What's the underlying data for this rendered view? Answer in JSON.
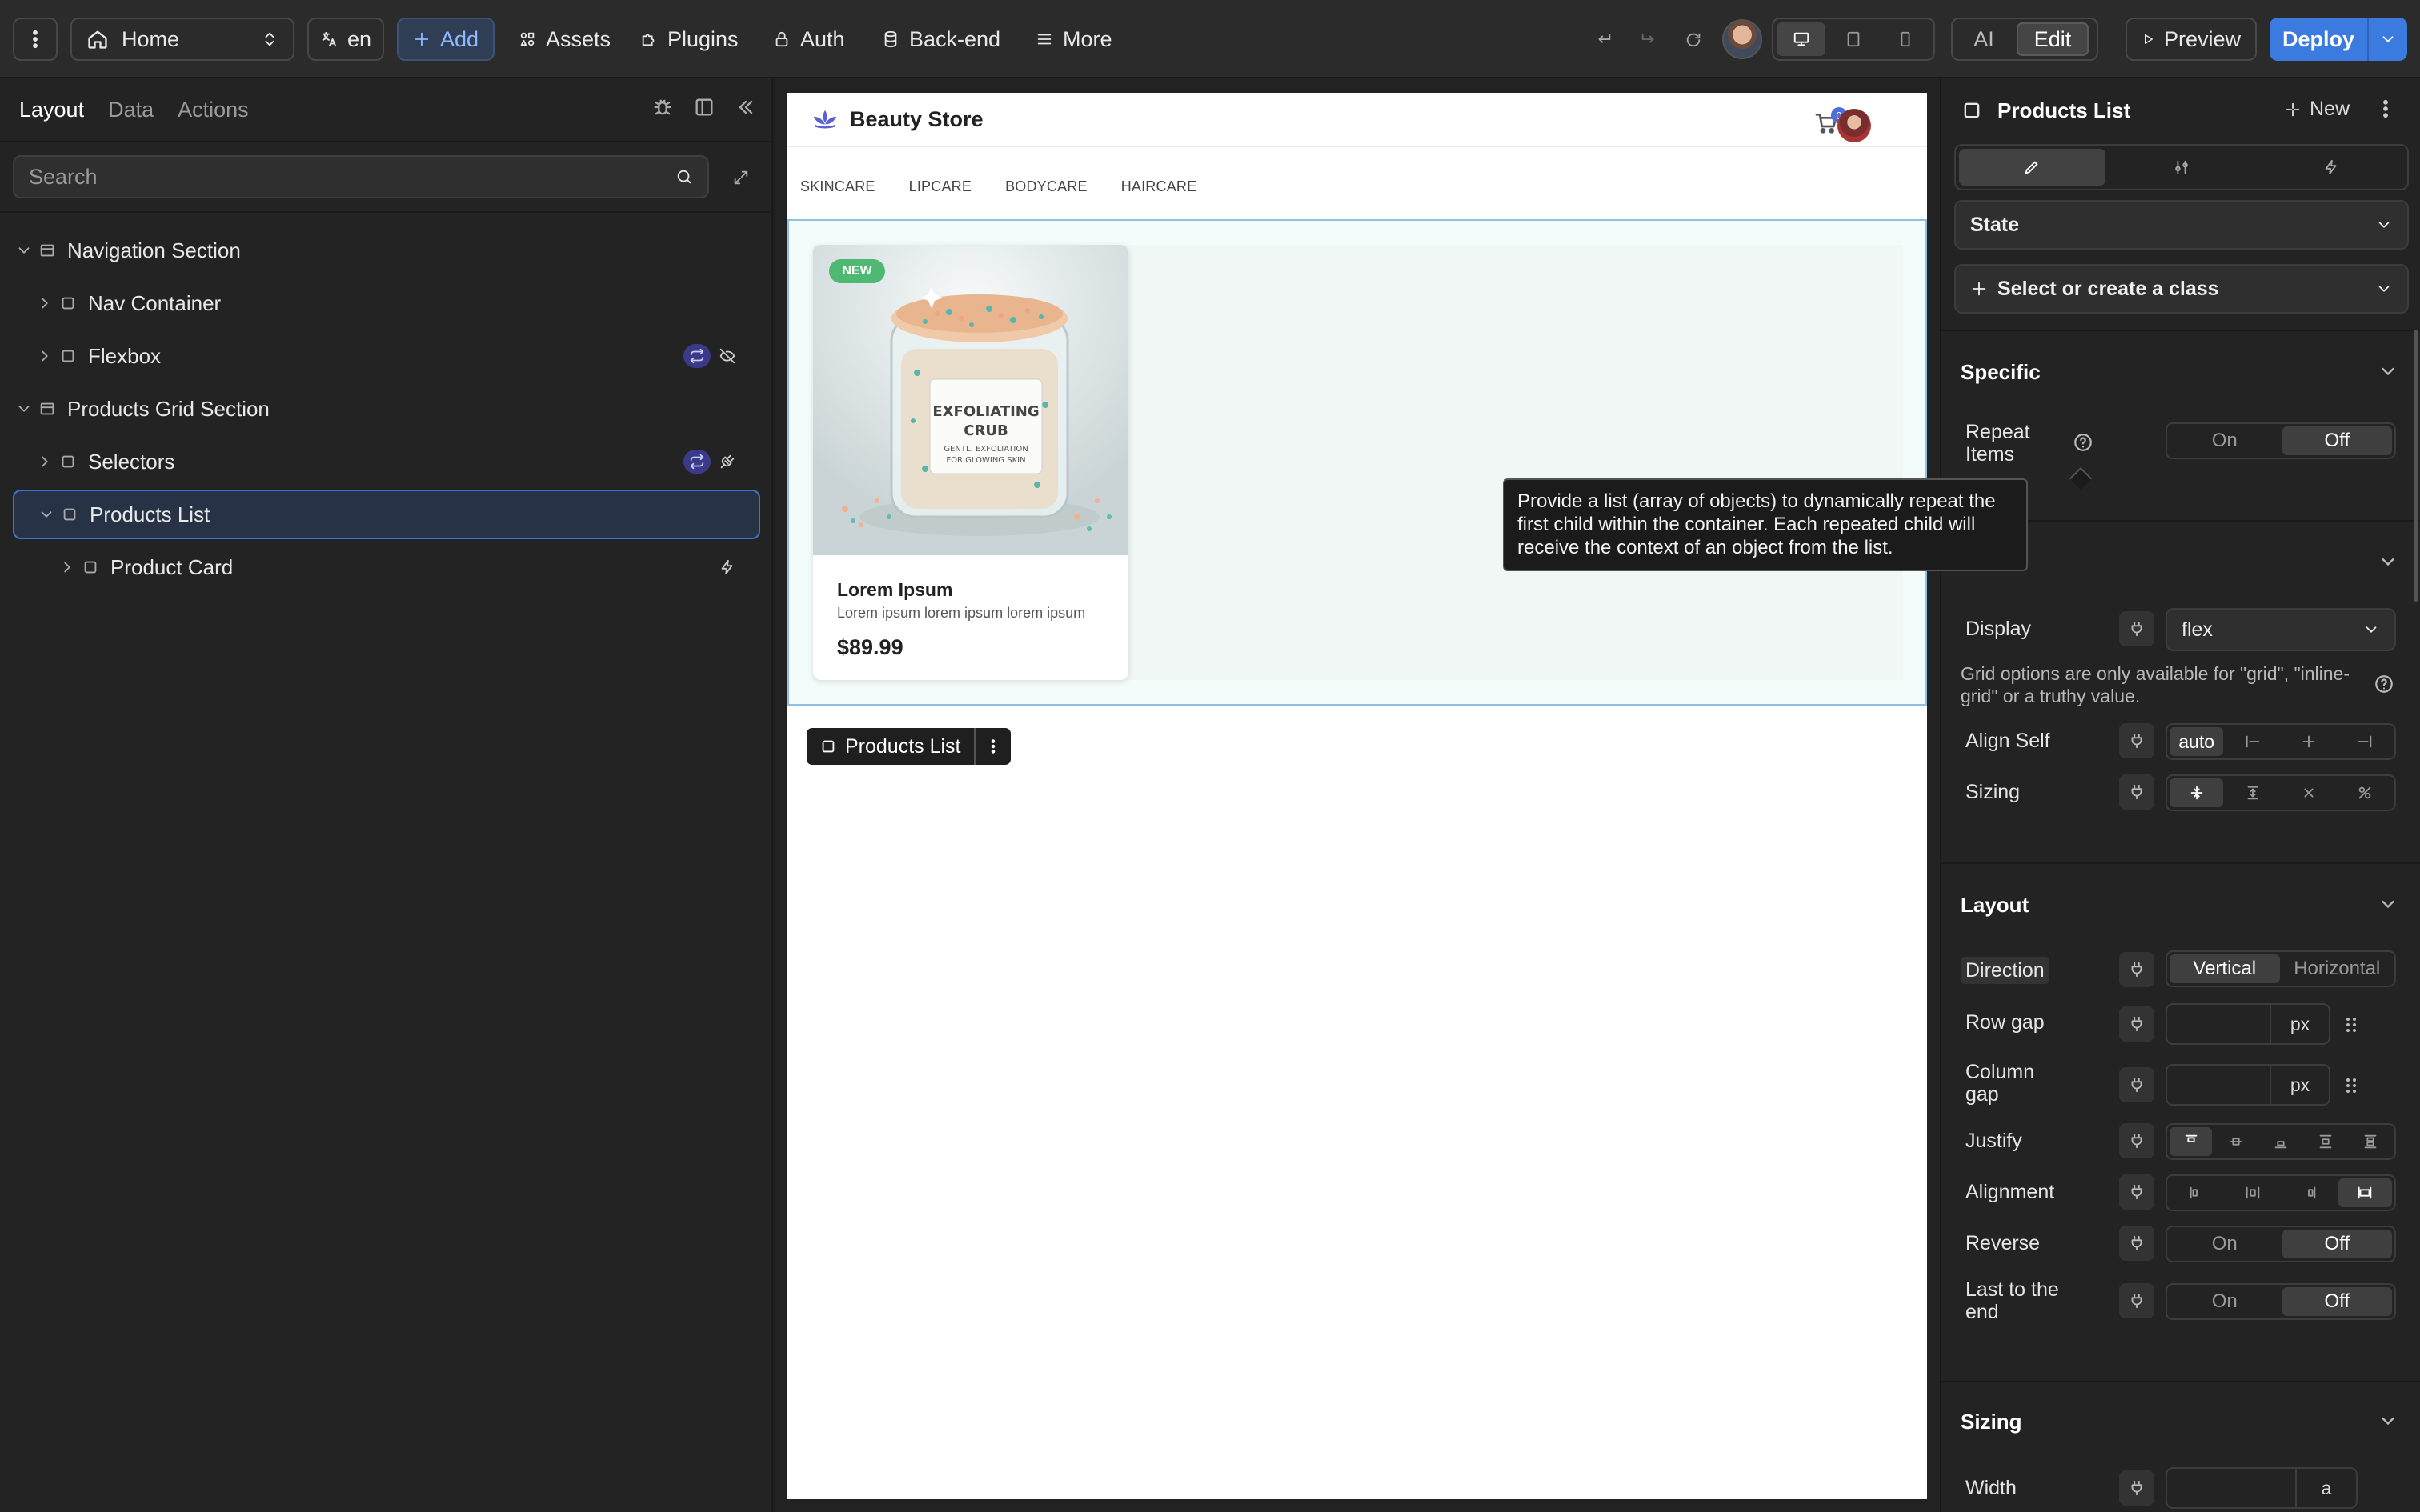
{
  "topbar": {
    "page": "Home",
    "language": "en",
    "add": "Add",
    "assets": "Assets",
    "plugins": "Plugins",
    "auth": "Auth",
    "backend": "Back-end",
    "more": "More",
    "mode_ai": "AI",
    "mode_edit": "Edit",
    "preview": "Preview",
    "deploy": "Deploy"
  },
  "left_panel": {
    "tabs": [
      "Layout",
      "Data",
      "Actions"
    ],
    "search_placeholder": "Search",
    "tree": [
      {
        "label": "Navigation Section"
      },
      {
        "label": "Nav Container"
      },
      {
        "label": "Flexbox"
      },
      {
        "label": "Products Grid Section"
      },
      {
        "label": "Selectors"
      },
      {
        "label": "Products List"
      },
      {
        "label": "Product Card"
      }
    ]
  },
  "canvas": {
    "site_title": "Beauty Store",
    "cart_count": "0",
    "categories": [
      "SKINCARE",
      "LIPCARE",
      "BODYCARE",
      "HAIRCARE"
    ],
    "product": {
      "badge": "NEW",
      "jar_label_1": "EXFOLIATING",
      "jar_label_2": "CRUB",
      "jar_label_3": "GENTL. EXFOLIATION",
      "jar_label_4": "FOR GLOWING SKIN",
      "name": "Lorem Ipsum",
      "description": "Lorem ipsum lorem ipsum lorem ipsum",
      "price": "$89.99"
    },
    "selection_label": "Products List"
  },
  "right_panel": {
    "title": "Products List",
    "new": "New",
    "state": "State",
    "class_select": "Select or create a class",
    "specific": {
      "title": "Specific",
      "repeat_items": "Repeat Items",
      "on": "On",
      "off": "Off"
    },
    "tooltip": "Provide a list (array of objects) to dynamically repeat the first child within the container. Each repeated child will receive the context of an object from the list.",
    "display": {
      "label": "Display",
      "value": "flex",
      "hint": "Grid options are only available for \"grid\", \"inline-grid\" or a truthy value.",
      "align_self": "Align Self",
      "align_self_value": "auto",
      "sizing": "Sizing"
    },
    "layout": {
      "title": "Layout",
      "direction": "Direction",
      "vertical": "Vertical",
      "horizontal": "Horizontal",
      "row_gap": "Row gap",
      "column_gap": "Column gap",
      "unit": "px",
      "justify": "Justify",
      "alignment": "Alignment",
      "reverse": "Reverse",
      "last_to_end": "Last to the end",
      "on": "On",
      "off": "Off"
    },
    "sizing": {
      "title": "Sizing",
      "width": "Width",
      "width_unit": "a"
    }
  }
}
